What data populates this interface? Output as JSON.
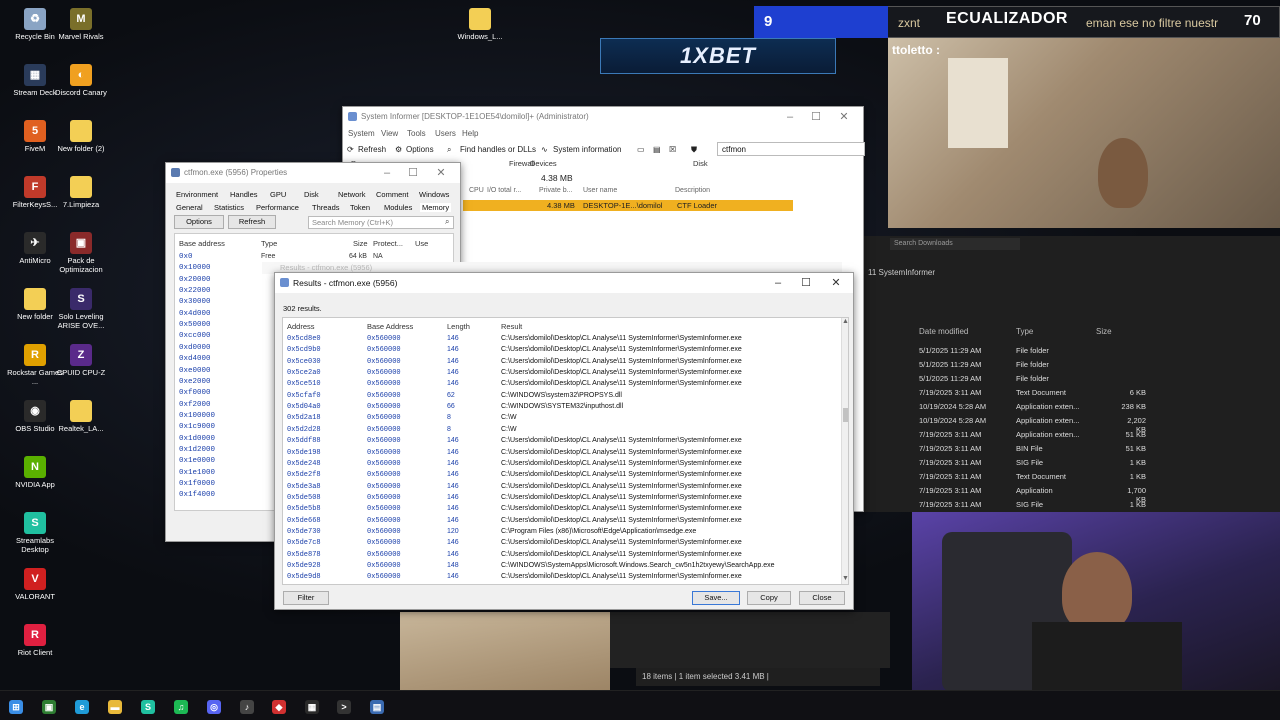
{
  "desktop_icons": [
    {
      "label": "Recycle Bin",
      "color": "#8aa4c4",
      "glyph": "♻"
    },
    {
      "label": "Marvel Rivals",
      "color": "#7a6f2a",
      "glyph": "M"
    },
    {
      "label": "Stream Deck",
      "color": "#2a3b5a",
      "glyph": "▦"
    },
    {
      "label": "Discord Canary",
      "color": "#f0a020",
      "glyph": "◐"
    },
    {
      "label": "FiveM",
      "color": "#e06020",
      "glyph": "5"
    },
    {
      "label": "New folder (2)",
      "color": "#f3cf55",
      "glyph": ""
    },
    {
      "label": "FilterKeysS...",
      "color": "#c03a2a",
      "glyph": "F"
    },
    {
      "label": "7.Limpieza",
      "color": "#f3cf55",
      "glyph": ""
    },
    {
      "label": "AntiMicro",
      "color": "#2a2a2a",
      "glyph": "✈"
    },
    {
      "label": "Pack de Optimizacion",
      "color": "#8a2a2a",
      "glyph": "▣"
    },
    {
      "label": "New folder",
      "color": "#f3cf55",
      "glyph": ""
    },
    {
      "label": "Solo Leveling ARISE OVE...",
      "color": "#3a2a6a",
      "glyph": "S"
    },
    {
      "label": "Rockstar Games ...",
      "color": "#e0a000",
      "glyph": "R"
    },
    {
      "label": "CPUID CPU-Z",
      "color": "#5a2a8a",
      "glyph": "Z"
    },
    {
      "label": "OBS Studio",
      "color": "#2a2a2a",
      "glyph": "◉"
    },
    {
      "label": "Realtek_LA...",
      "color": "#f3cf55",
      "glyph": ""
    },
    {
      "label": "NVIDIA App",
      "color": "#5ab000",
      "glyph": "N"
    },
    {
      "label": "Streamlabs Desktop",
      "color": "#20c0a0",
      "glyph": "S"
    },
    {
      "label": "VALORANT",
      "color": "#d02020",
      "glyph": "V"
    },
    {
      "label": "Riot Client",
      "color": "#e02040",
      "glyph": "R"
    },
    {
      "label": "Windows_L...",
      "color": "#f3cf55",
      "glyph": ""
    }
  ],
  "overlay": {
    "banner": "1XBET",
    "counter": "9",
    "title": "ECUALIZADOR",
    "number": "70",
    "chat_user": "zxnt",
    "chat_text": "eman ese no filtre nuestr",
    "chat_user2": "ttoletto :"
  },
  "system_informer": {
    "title": "System Informer [DESKTOP-1E1OE54\\domilol]+ (Administrator)",
    "menu": [
      "System",
      "View",
      "Tools",
      "Users",
      "Help"
    ],
    "toolbar": {
      "refresh": "Refresh",
      "options": "Options",
      "find": "Find handles or DLLs",
      "sysinfo": "System information"
    },
    "search_value": "ctfmon",
    "tabs": [
      "Processes",
      "Services",
      "Network",
      "Disk",
      "Firewall",
      "Devices"
    ],
    "columns": [
      "CPU",
      "I/O total r...",
      "Private b...",
      "User name",
      "Description"
    ],
    "summary": "4.38 MB",
    "row": {
      "private": "4.38 MB",
      "user": "DESKTOP-1E...\\domilol",
      "desc": "CTF Loader"
    }
  },
  "properties": {
    "title": "ctfmon.exe (5956) Properties",
    "tabs_row1": [
      "Environment",
      "Handles",
      "GPU",
      "Disk",
      "Network",
      "Comment",
      "Windows"
    ],
    "tabs_row2": [
      "General",
      "Statistics",
      "Performance",
      "Threads",
      "Token",
      "Modules",
      "Memory"
    ],
    "options": "Options",
    "refresh": "Refresh",
    "search_placeholder": "Search Memory (Ctrl+K)",
    "columns": [
      "Base address",
      "Type",
      "Size",
      "Protect...",
      "Use"
    ],
    "first_row": {
      "type": "Free",
      "size": "64 kB",
      "protect": "NA"
    },
    "addresses": [
      "0x0",
      "0x10000",
      "0x20000",
      "0x22000",
      "0x30000",
      "0x4d000",
      "0x50000",
      "0xcc000",
      "0xd0000",
      "0xd4000",
      "0xe0000",
      "0xe2000",
      "0xf0000",
      "0xf2000",
      "0x100000",
      "0x1c9000",
      "0x1d0000",
      "0x1d2000",
      "0x1e0000",
      "0x1e1000",
      "0x1f0000",
      "0x1f4000"
    ]
  },
  "results": {
    "title": "Results - ctfmon.exe (5956)",
    "ghost_title": "Results - ctfmon.exe (5956)",
    "count": "302 results.",
    "columns": [
      "Address",
      "Base Address",
      "Length",
      "Result"
    ],
    "rows": [
      [
        "0x5cd8e0",
        "0x560000",
        "146",
        "C:\\Users\\domilol\\Desktop\\CL Analyse\\11 SystemInformer\\SystemInformer.exe"
      ],
      [
        "0x5cd9b0",
        "0x560000",
        "146",
        "C:\\Users\\domilol\\Desktop\\CL Analyse\\11 SystemInformer\\SystemInformer.exe"
      ],
      [
        "0x5ce030",
        "0x560000",
        "146",
        "C:\\Users\\domilol\\Desktop\\CL Analyse\\11 SystemInformer\\SystemInformer.exe"
      ],
      [
        "0x5ce2a0",
        "0x560000",
        "146",
        "C:\\Users\\domilol\\Desktop\\CL Analyse\\11 SystemInformer\\SystemInformer.exe"
      ],
      [
        "0x5ce510",
        "0x560000",
        "146",
        "C:\\Users\\domilol\\Desktop\\CL Analyse\\11 SystemInformer\\SystemInformer.exe"
      ],
      [
        "0x5cfaf0",
        "0x560000",
        "62",
        "C:\\WINDOWS\\system32\\PROPSYS.dll"
      ],
      [
        "0x5d04a0",
        "0x560000",
        "66",
        "C:\\WINDOWS\\SYSTEM32\\inputhost.dll"
      ],
      [
        "0x5d2a18",
        "0x560000",
        "8",
        "C:\\W"
      ],
      [
        "0x5d2d28",
        "0x560000",
        "8",
        "C:\\W"
      ],
      [
        "0x5ddf88",
        "0x560000",
        "146",
        "C:\\Users\\domilol\\Desktop\\CL Analyse\\11 SystemInformer\\SystemInformer.exe"
      ],
      [
        "0x5de198",
        "0x560000",
        "146",
        "C:\\Users\\domilol\\Desktop\\CL Analyse\\11 SystemInformer\\SystemInformer.exe"
      ],
      [
        "0x5de248",
        "0x560000",
        "146",
        "C:\\Users\\domilol\\Desktop\\CL Analyse\\11 SystemInformer\\SystemInformer.exe"
      ],
      [
        "0x5de2f8",
        "0x560000",
        "146",
        "C:\\Users\\domilol\\Desktop\\CL Analyse\\11 SystemInformer\\SystemInformer.exe"
      ],
      [
        "0x5de3a8",
        "0x560000",
        "146",
        "C:\\Users\\domilol\\Desktop\\CL Analyse\\11 SystemInformer\\SystemInformer.exe"
      ],
      [
        "0x5de508",
        "0x560000",
        "146",
        "C:\\Users\\domilol\\Desktop\\CL Analyse\\11 SystemInformer\\SystemInformer.exe"
      ],
      [
        "0x5de5b8",
        "0x560000",
        "146",
        "C:\\Users\\domilol\\Desktop\\CL Analyse\\11 SystemInformer\\SystemInformer.exe"
      ],
      [
        "0x5de668",
        "0x560000",
        "146",
        "C:\\Users\\domilol\\Desktop\\CL Analyse\\11 SystemInformer\\SystemInformer.exe"
      ],
      [
        "0x5de730",
        "0x560000",
        "120",
        "C:\\Program Files (x86)\\Microsoft\\Edge\\Application\\msedge.exe"
      ],
      [
        "0x5de7c8",
        "0x560000",
        "146",
        "C:\\Users\\domilol\\Desktop\\CL Analyse\\11 SystemInformer\\SystemInformer.exe"
      ],
      [
        "0x5de878",
        "0x560000",
        "146",
        "C:\\Users\\domilol\\Desktop\\CL Analyse\\11 SystemInformer\\SystemInformer.exe"
      ],
      [
        "0x5de928",
        "0x560000",
        "148",
        "C:\\WINDOWS\\SystemApps\\Microsoft.Windows.Search_cw5n1h2txyewy\\SearchApp.exe"
      ],
      [
        "0x5de9d8",
        "0x560000",
        "146",
        "C:\\Users\\domilol\\Desktop\\CL Analyse\\11 SystemInformer\\SystemInformer.exe"
      ]
    ],
    "buttons": {
      "filter": "Filter",
      "save": "Save...",
      "copy": "Copy",
      "close": "Close"
    }
  },
  "explorer": {
    "search": "Search Downloads",
    "path": "11 SystemInformer",
    "columns": [
      "Date modified",
      "Type",
      "Size"
    ],
    "rows": [
      [
        "5/1/2025 11:29 AM",
        "File folder",
        ""
      ],
      [
        "5/1/2025 11:29 AM",
        "File folder",
        ""
      ],
      [
        "5/1/2025 11:29 AM",
        "File folder",
        ""
      ],
      [
        "7/19/2025 3:11 AM",
        "Text Document",
        "6 KB"
      ],
      [
        "10/19/2024 5:28 AM",
        "Application exten...",
        "238 KB"
      ],
      [
        "10/19/2024 5:28 AM",
        "Application exten...",
        "2,202 KB"
      ],
      [
        "7/19/2025 3:11 AM",
        "Application exten...",
        "51 KB"
      ],
      [
        "7/19/2025 3:11 AM",
        "BIN File",
        "51 KB"
      ],
      [
        "7/19/2025 3:11 AM",
        "SIG File",
        "1 KB"
      ],
      [
        "7/19/2025 3:11 AM",
        "Text Document",
        "1 KB"
      ],
      [
        "7/19/2025 3:11 AM",
        "Application",
        "1,700 KB"
      ],
      [
        "7/19/2025 3:11 AM",
        "SIG File",
        "1 KB"
      ]
    ],
    "status": "18 items  |  1 item selected  3.41 MB  |"
  },
  "taskbar": [
    {
      "name": "start-icon",
      "color": "#3a8ee6",
      "glyph": "⊞"
    },
    {
      "name": "app-icon",
      "color": "#2e7d32",
      "glyph": "▣"
    },
    {
      "name": "edge-icon",
      "color": "#1f9bd8",
      "glyph": "e"
    },
    {
      "name": "file-explorer-icon",
      "color": "#e8b93a",
      "glyph": "▬"
    },
    {
      "name": "streamlabs-icon",
      "color": "#20c0a0",
      "glyph": "S"
    },
    {
      "name": "spotify-icon",
      "color": "#1db954",
      "glyph": "♫"
    },
    {
      "name": "discord-icon",
      "color": "#5865f2",
      "glyph": "◎"
    },
    {
      "name": "audio-icon",
      "color": "#444",
      "glyph": "♪"
    },
    {
      "name": "app-red-icon",
      "color": "#d03030",
      "glyph": "◆"
    },
    {
      "name": "app-dark-icon",
      "color": "#2a2a2a",
      "glyph": "▦"
    },
    {
      "name": "terminal-icon",
      "color": "#333",
      "glyph": ">"
    },
    {
      "name": "system-informer-icon",
      "color": "#3a6ab0",
      "glyph": "▤"
    }
  ]
}
